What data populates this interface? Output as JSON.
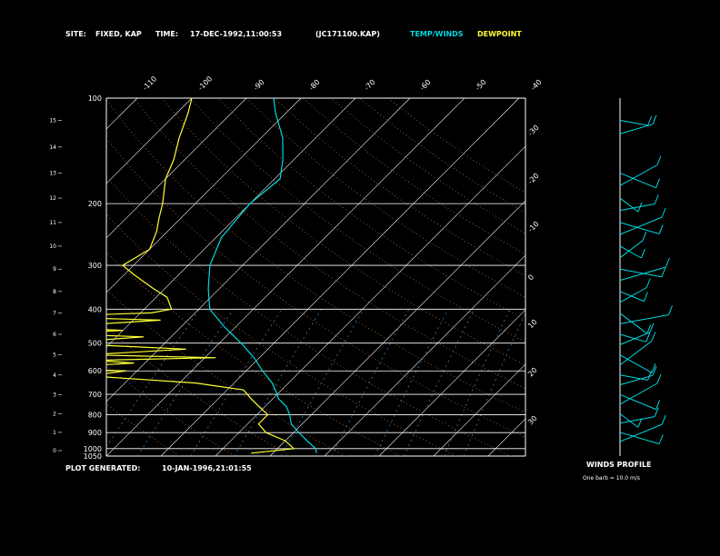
{
  "header": {
    "site_label": "SITE:",
    "site_value": "FIXED, KAP",
    "time_label": "TIME:",
    "time_value": "17-DEC-1992,11:00:53",
    "file_id": "(JC171100.KAP)",
    "temp_legend": "TEMP/WINDS",
    "dew_legend": "DEWPOINT"
  },
  "footer": {
    "generated_label": "PLOT GENERATED:",
    "generated_value": "10-JAN-1996,21:01:55"
  },
  "winds": {
    "title": "WINDS PROFILE",
    "note": "One barb = 10.0 m/s"
  },
  "colors": {
    "background": "#000000",
    "temperature": "#00d8e0",
    "dewpoint": "#ffff33",
    "grid": "#ffffff",
    "mixing_ratio": "#3a8fd0",
    "dry_adiabat": "#c87a3a"
  },
  "chart_data": {
    "type": "line",
    "pressure_labels": [
      "100",
      "200",
      "300",
      "400",
      "500",
      "600",
      "700",
      "800",
      "900",
      "1000",
      "1050"
    ],
    "pressure_levels": [
      100,
      200,
      300,
      400,
      500,
      600,
      700,
      800,
      900,
      1000,
      1050
    ],
    "height_km_labels": [
      "15",
      "14",
      "13",
      "12",
      "11",
      "10",
      "9",
      "8",
      "7",
      "6",
      "5",
      "4",
      "3",
      "2",
      "1",
      "0"
    ],
    "height_km_values": [
      15,
      14,
      13,
      12,
      11,
      10,
      9,
      8,
      7,
      6,
      5,
      4,
      3,
      2,
      1,
      0
    ],
    "top_isotherm_labels": [
      "-110",
      "-100",
      "-90",
      "-80",
      "-70",
      "-60",
      "-50",
      "-40"
    ],
    "top_isotherm_values": [
      -110,
      -100,
      -90,
      -80,
      -70,
      -60,
      -50,
      -40
    ],
    "right_isotherm_labels": [
      "-30",
      "-20",
      "-10",
      "0",
      "10",
      "20",
      "30"
    ],
    "right_isotherm_values": [
      -30,
      -20,
      -10,
      0,
      10,
      20,
      30
    ],
    "series": [
      {
        "name": "TEMP/WINDS",
        "pressure": [
          1030,
          1000,
          950,
          900,
          850,
          800,
          760,
          720,
          700,
          650,
          600,
          550,
          500,
          450,
          400,
          350,
          300,
          250,
          200,
          170,
          150,
          130,
          110,
          100
        ],
        "temperature": [
          -2,
          -3,
          -6,
          -9,
          -12,
          -14,
          -16,
          -19,
          -20,
          -23,
          -27,
          -31,
          -36,
          -42,
          -48,
          -52,
          -56,
          -59,
          -60,
          -59,
          -62,
          -66,
          -72,
          -75
        ]
      },
      {
        "name": "DEWPOINT",
        "pressure": [
          1030,
          1000,
          950,
          900,
          850,
          800,
          760,
          720,
          680,
          650,
          620,
          600,
          590,
          570,
          560,
          550,
          540,
          520,
          500,
          480,
          470,
          460,
          450,
          430,
          420,
          410,
          400,
          370,
          350,
          320,
          300,
          270,
          240,
          220,
          200,
          170,
          150,
          130,
          110,
          100
        ],
        "dewpoint": [
          -14,
          -7,
          -10,
          -15,
          -18,
          -18,
          -21,
          -24,
          -27,
          -37,
          -58,
          -52,
          -68,
          -52,
          -60,
          -38,
          -62,
          -45,
          -70,
          -55,
          -72,
          -60,
          -74,
          -55,
          -78,
          -58,
          -55,
          -58,
          -62,
          -68,
          -72,
          -70,
          -72,
          -74,
          -76,
          -80,
          -82,
          -85,
          -88,
          -90
        ]
      }
    ],
    "wind_levels_km": [
      15,
      14.5,
      13,
      12.5,
      12,
      11.5,
      11,
      10.5,
      10,
      9.5,
      9,
      8.5,
      8,
      7.5,
      7,
      6.5,
      6,
      5.5,
      5,
      4.5,
      4,
      3.5,
      3,
      2.5,
      2,
      1.5,
      1,
      0.5
    ],
    "xlim": [
      -40,
      50
    ],
    "ylim": [
      1050,
      100
    ]
  }
}
